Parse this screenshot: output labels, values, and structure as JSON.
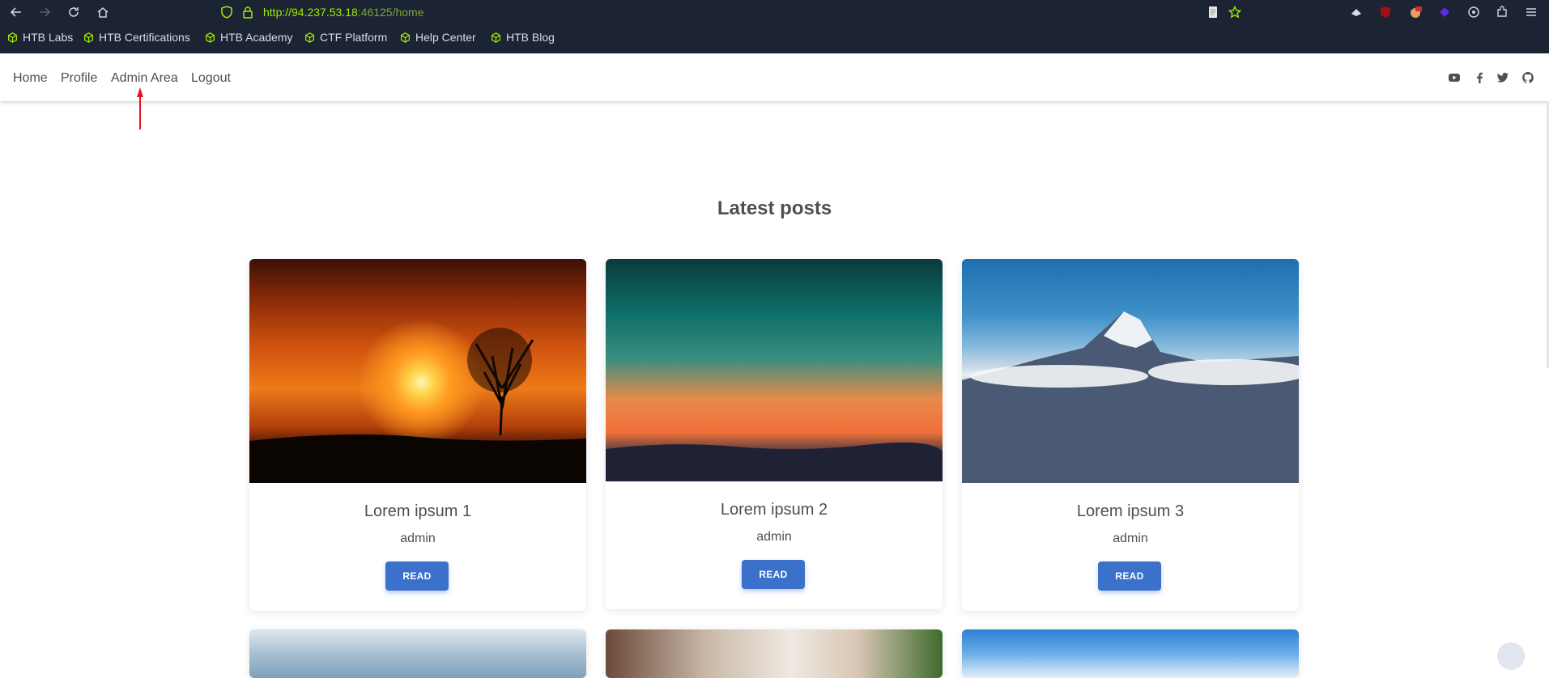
{
  "browser": {
    "url_host": "http://94.237.53.18",
    "url_rest": ":46125/home",
    "bookmarks": [
      {
        "label": "HTB Labs",
        "icon": "cube-icon"
      },
      {
        "label": "HTB Certifications",
        "icon": "cube-icon"
      },
      {
        "label": "HTB Academy",
        "icon": "cube-icon"
      },
      {
        "label": "CTF Platform",
        "icon": "cube-icon"
      },
      {
        "label": "Help Center",
        "icon": "cube-icon"
      },
      {
        "label": "HTB Blog",
        "icon": "cube-icon"
      }
    ],
    "colors": {
      "chrome_bg": "#1c2333",
      "url_accent": "#9fef00"
    }
  },
  "nav": {
    "links": [
      "Home",
      "Profile",
      "Admin Area",
      "Logout"
    ],
    "social_icons": [
      "youtube-icon",
      "facebook-icon",
      "twitter-icon",
      "github-icon"
    ]
  },
  "annotation": {
    "color": "#e8141b",
    "points_to": "Admin Area"
  },
  "main": {
    "title": "Latest posts",
    "posts": [
      {
        "title": "Lorem ipsum 1",
        "author": "admin",
        "button": "READ"
      },
      {
        "title": "Lorem ipsum 2",
        "author": "admin",
        "button": "READ"
      },
      {
        "title": "Lorem ipsum 3",
        "author": "admin",
        "button": "READ"
      }
    ],
    "accent": "#3b71ca"
  }
}
